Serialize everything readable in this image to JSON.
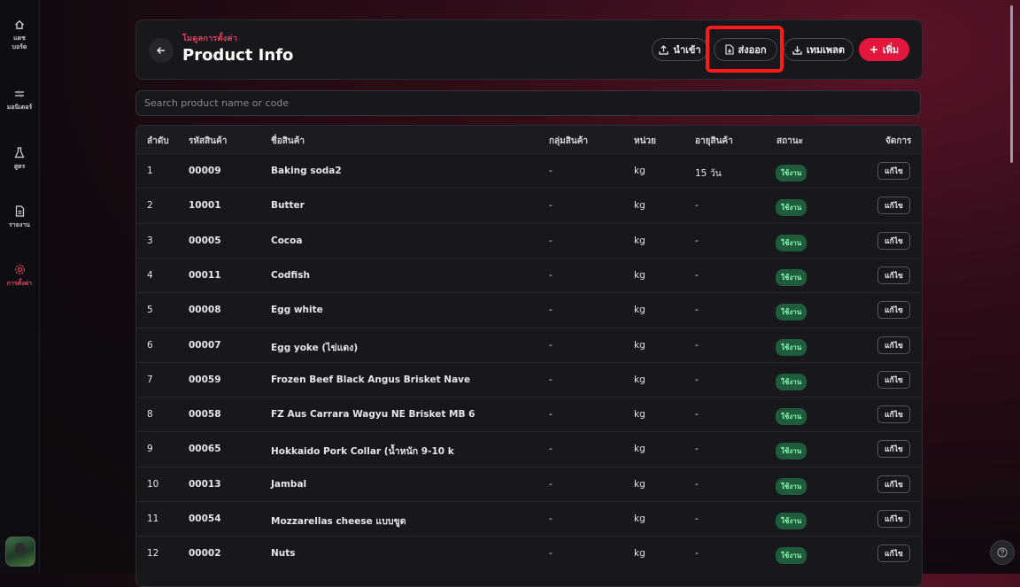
{
  "sidebar": {
    "items": [
      {
        "label": "แดช\nบอร์ด",
        "icon": "home-icon",
        "active": false
      },
      {
        "label": "มอนิเตอร์",
        "icon": "monitor-icon",
        "active": false
      },
      {
        "label": "สูตร",
        "icon": "flask-icon",
        "active": false
      },
      {
        "label": "รายงาน",
        "icon": "report-icon",
        "active": false
      },
      {
        "label": "การตั้งค่า",
        "icon": "gear-icon",
        "active": true
      }
    ]
  },
  "header": {
    "breadcrumb": "โมดูลการตั้งค่า",
    "title": "Product Info",
    "buttons": {
      "import": "นำเข้า",
      "export": "ส่งออก",
      "template": "เทมเพลต",
      "add": "เพิ่ม"
    }
  },
  "search": {
    "placeholder": "Search product name or code",
    "value": ""
  },
  "table": {
    "columns": [
      "ลำดับ",
      "รหัสสินค้า",
      "ชื่อสินค้า",
      "กลุ่มสินค้า",
      "หน่วย",
      "อายุสินค้า",
      "สถานะ",
      "จัดการ"
    ],
    "rows": [
      {
        "no": "1",
        "code": "00009",
        "name": "Baking soda2",
        "group": "-",
        "unit": "kg",
        "shelf": "15 วัน",
        "status": "ใช้งาน",
        "action": "แก้ไข"
      },
      {
        "no": "2",
        "code": "10001",
        "name": "Butter",
        "group": "-",
        "unit": "kg",
        "shelf": "-",
        "status": "ใช้งาน",
        "action": "แก้ไข"
      },
      {
        "no": "3",
        "code": "00005",
        "name": "Cocoa",
        "group": "-",
        "unit": "kg",
        "shelf": "-",
        "status": "ใช้งาน",
        "action": "แก้ไข"
      },
      {
        "no": "4",
        "code": "00011",
        "name": "Codfish",
        "group": "-",
        "unit": "kg",
        "shelf": "-",
        "status": "ใช้งาน",
        "action": "แก้ไข"
      },
      {
        "no": "5",
        "code": "00008",
        "name": "Egg white",
        "group": "-",
        "unit": "kg",
        "shelf": "-",
        "status": "ใช้งาน",
        "action": "แก้ไข"
      },
      {
        "no": "6",
        "code": "00007",
        "name": "Egg yoke (ไข่แดง)",
        "group": "-",
        "unit": "kg",
        "shelf": "-",
        "status": "ใช้งาน",
        "action": "แก้ไข"
      },
      {
        "no": "7",
        "code": "00059",
        "name": "Frozen Beef Black Angus Brisket Nave",
        "group": "-",
        "unit": "kg",
        "shelf": "-",
        "status": "ใช้งาน",
        "action": "แก้ไข"
      },
      {
        "no": "8",
        "code": "00058",
        "name": "FZ Aus Carrara Wagyu NE Brisket MB 6",
        "group": "-",
        "unit": "kg",
        "shelf": "-",
        "status": "ใช้งาน",
        "action": "แก้ไข"
      },
      {
        "no": "9",
        "code": "00065",
        "name": "Hokkaido Pork Collar (น้ำหนัก 9-10 k",
        "group": "-",
        "unit": "kg",
        "shelf": "-",
        "status": "ใช้งาน",
        "action": "แก้ไข"
      },
      {
        "no": "10",
        "code": "00013",
        "name": "Jambal",
        "group": "-",
        "unit": "kg",
        "shelf": "-",
        "status": "ใช้งาน",
        "action": "แก้ไข"
      },
      {
        "no": "11",
        "code": "00054",
        "name": "Mozzarellas cheese แบบขูด",
        "group": "-",
        "unit": "kg",
        "shelf": "-",
        "status": "ใช้งาน",
        "action": "แก้ไข"
      },
      {
        "no": "12",
        "code": "00002",
        "name": "Nuts",
        "group": "-",
        "unit": "kg",
        "shelf": "-",
        "status": "ใช้งาน",
        "action": "แก้ไข"
      }
    ]
  },
  "colors": {
    "accent": "#e3173e",
    "active_nav": "#e0455f",
    "status_bg": "#1f5c3c",
    "status_fg": "#8ff2b6",
    "highlight": "#ff1a1a"
  }
}
